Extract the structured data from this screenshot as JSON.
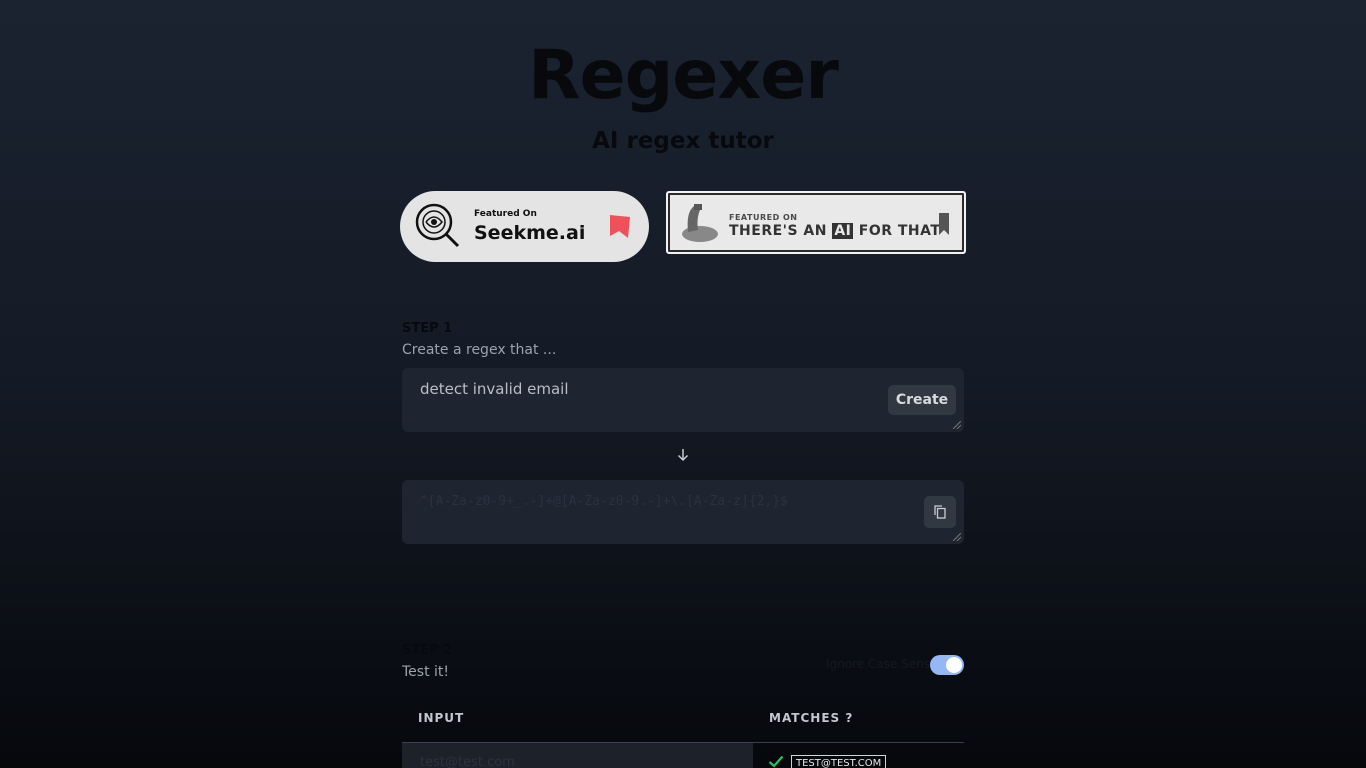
{
  "header": {
    "title": "Regexer",
    "subtitle": "AI regex tutor"
  },
  "badges": {
    "seekme": {
      "featured": "Featured On",
      "name": "Seekme.ai"
    },
    "taaft": {
      "featured": "FEATURED ON",
      "name_pre": "THERE'S AN ",
      "name_ai": "AI",
      "name_post": " FOR THAT"
    }
  },
  "step1": {
    "label": "STEP 1",
    "description": "Create a regex that ...",
    "prompt_value": "detect invalid email",
    "create_label": "Create",
    "regex_output": "^[A-Za-z0-9+_.-]+@[A-Za-z0-9.-]+\\.[A-Za-z]{2,}$"
  },
  "step2": {
    "label": "STEP 2",
    "description": "Test it!",
    "case_label": "Ignore Case Sens.",
    "case_enabled": true,
    "columns": [
      "INPUT",
      "MATCHES ?"
    ],
    "rows": [
      {
        "input": "test@test.com",
        "match": "TEST@TEST.COM",
        "matched": true
      }
    ]
  },
  "colors": {
    "accent_toggle": "#93b8f5",
    "match_check": "#22c55e",
    "bookmark_red": "#f0505a"
  }
}
